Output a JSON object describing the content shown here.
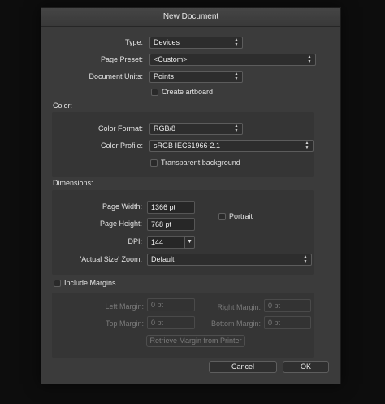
{
  "dialog": {
    "title": "New Document"
  },
  "general": {
    "type_label": "Type:",
    "type_value": "Devices",
    "preset_label": "Page Preset:",
    "preset_value": "<Custom>",
    "units_label": "Document Units:",
    "units_value": "Points",
    "create_artboard": {
      "label": "Create artboard",
      "checked": false
    }
  },
  "color": {
    "section_label": "Color:",
    "format_label": "Color Format:",
    "format_value": "RGB/8",
    "profile_label": "Color Profile:",
    "profile_value": "sRGB IEC61966-2.1",
    "transparent": {
      "label": "Transparent background",
      "checked": false
    }
  },
  "dimensions": {
    "section_label": "Dimensions:",
    "width_label": "Page Width:",
    "width_value": "1366 pt",
    "height_label": "Page Height:",
    "height_value": "768 pt",
    "portrait": {
      "label": "Portrait",
      "checked": false
    },
    "dpi_label": "DPI:",
    "dpi_value": "144",
    "zoom_label": "'Actual Size' Zoom:",
    "zoom_value": "Default"
  },
  "margins": {
    "include": {
      "label": "Include Margins",
      "checked": false
    },
    "left_label": "Left Margin:",
    "left_value": "0 pt",
    "right_label": "Right Margin:",
    "right_value": "0 pt",
    "top_label": "Top Margin:",
    "top_value": "0 pt",
    "bottom_label": "Bottom Margin:",
    "bottom_value": "0 pt",
    "retrieve_label": "Retrieve Margin from Printer"
  },
  "buttons": {
    "cancel": "Cancel",
    "ok": "OK"
  },
  "icons": {
    "updown": "up-down-arrows-icon",
    "dropdown": "triangle-down-icon"
  },
  "colors": {
    "dialog_bg": "#3b3b3b",
    "panel_bg": "#353535",
    "field_bg": "#2d2d2d",
    "backdrop": "#0d0d0d"
  }
}
